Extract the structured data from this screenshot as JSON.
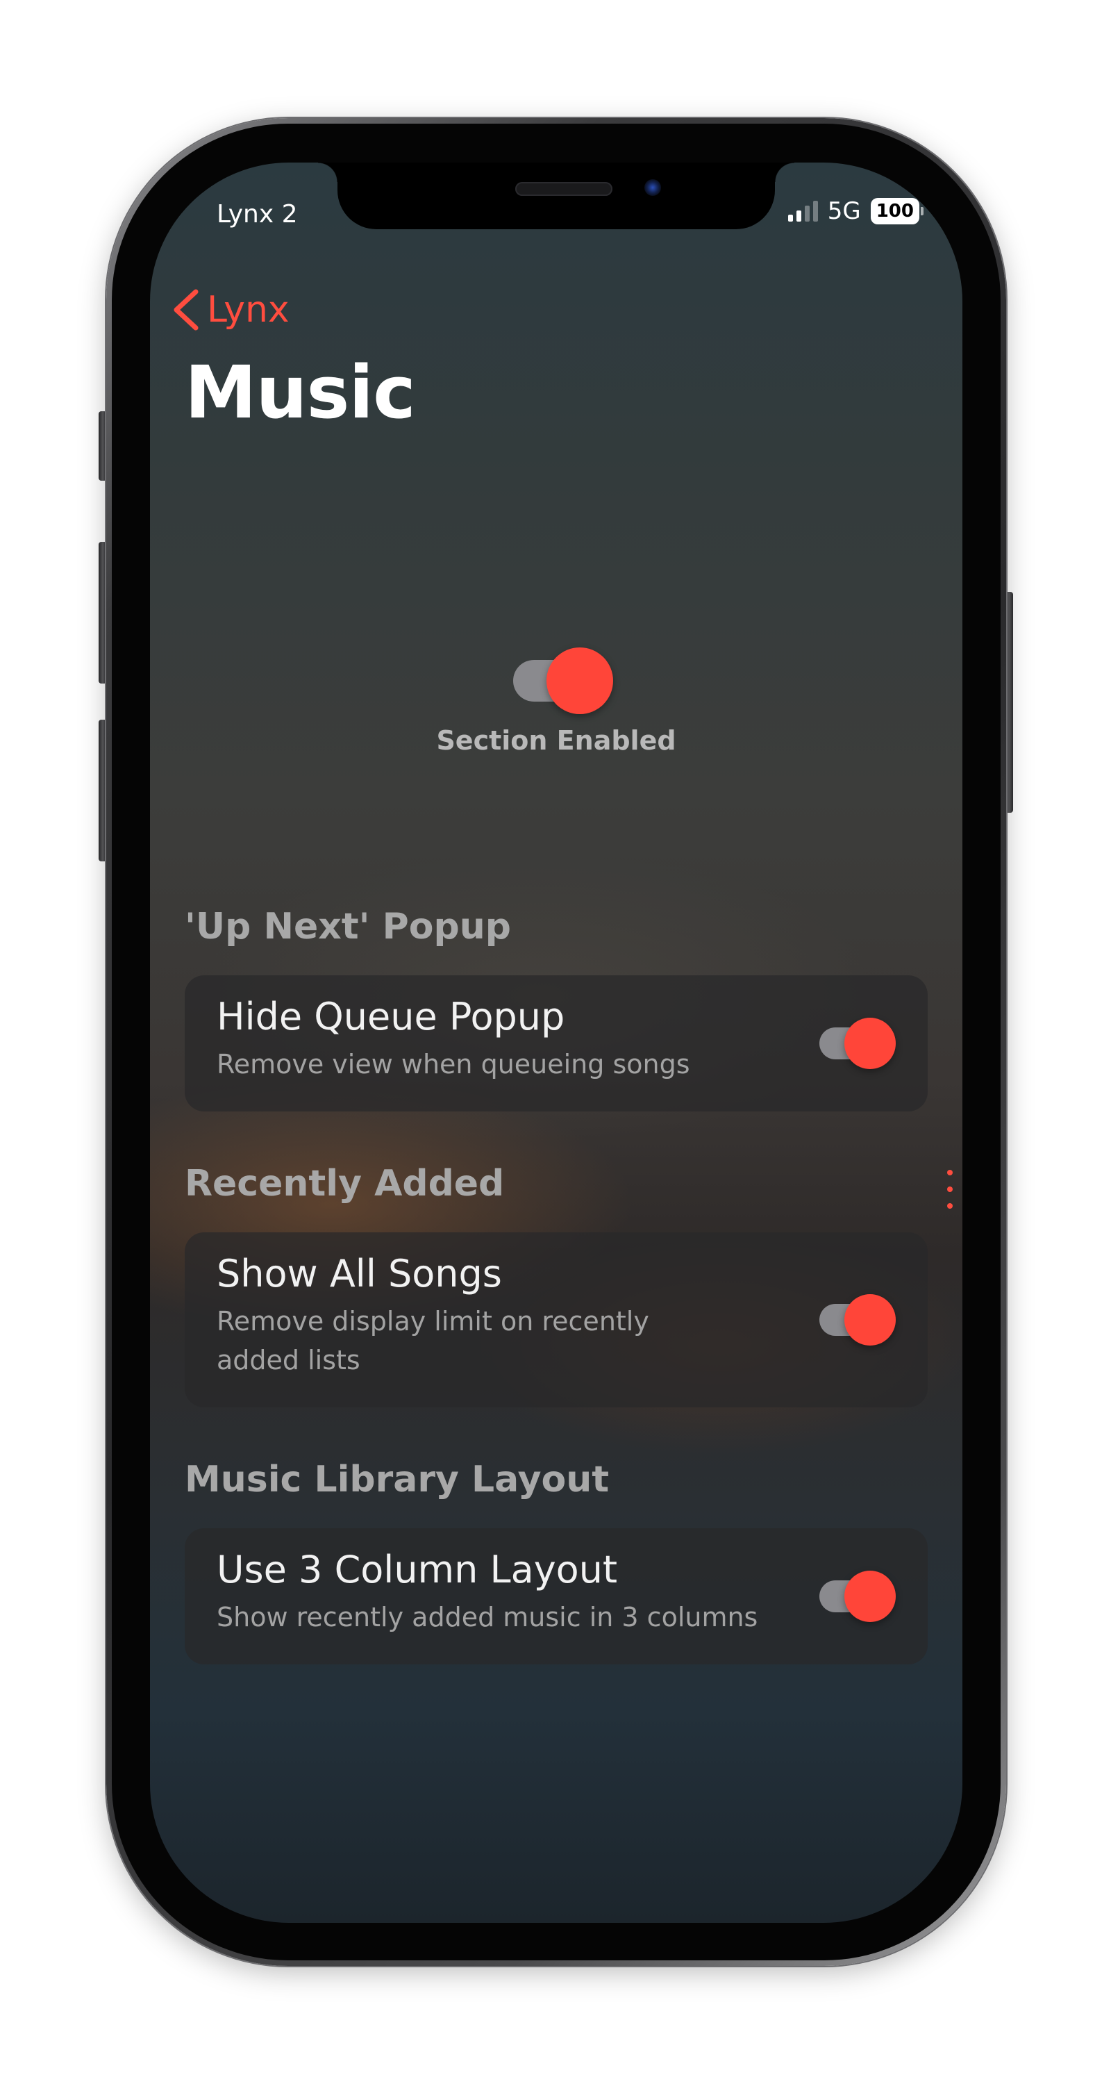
{
  "status_bar": {
    "carrier": "Lynx 2",
    "network": "5G",
    "battery": "100"
  },
  "nav": {
    "back_label": "Lynx",
    "title": "Music"
  },
  "master_toggle": {
    "label": "Section Enabled",
    "on": true
  },
  "sections": [
    {
      "header": "'Up Next' Popup",
      "rows": [
        {
          "title": "Hide Queue Popup",
          "subtitle": "Remove view when queueing songs",
          "on": true
        }
      ]
    },
    {
      "header": "Recently Added",
      "rows": [
        {
          "title": "Show All Songs",
          "subtitle_line1": "Remove display limit on recently",
          "subtitle_line2": "added lists",
          "on": true
        }
      ]
    },
    {
      "header": "Music Library Layout",
      "rows": [
        {
          "title": "Use 3 Column Layout",
          "subtitle": "Show recently added music in 3 columns",
          "on": true
        }
      ]
    }
  ],
  "colors": {
    "accent": "#ff4539",
    "toggle_track": "#8a8a8e"
  }
}
